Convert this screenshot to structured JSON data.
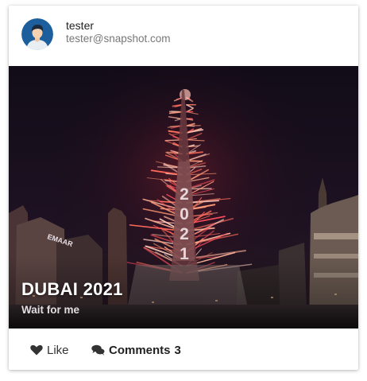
{
  "user": {
    "name": "tester",
    "email": "tester@snapshot.com",
    "avatar_icon": "user-avatar-icon"
  },
  "post": {
    "image_icon": "burj-khalifa-fireworks-photo",
    "image_sign_text": "EMAAR",
    "image_tower_text": "2021",
    "title": "DUBAI 2021",
    "subtitle": "Wait for me"
  },
  "actions": {
    "like_label": "Like",
    "like_icon": "heart-icon",
    "comments_label": "Comments",
    "comments_count": "3",
    "comments_icon": "comments-icon"
  },
  "colors": {
    "avatar_bg": "#1d5f9c",
    "card_bg": "#ffffff",
    "night_sky": "#150d16",
    "fireworks": "#ff6a5a"
  }
}
